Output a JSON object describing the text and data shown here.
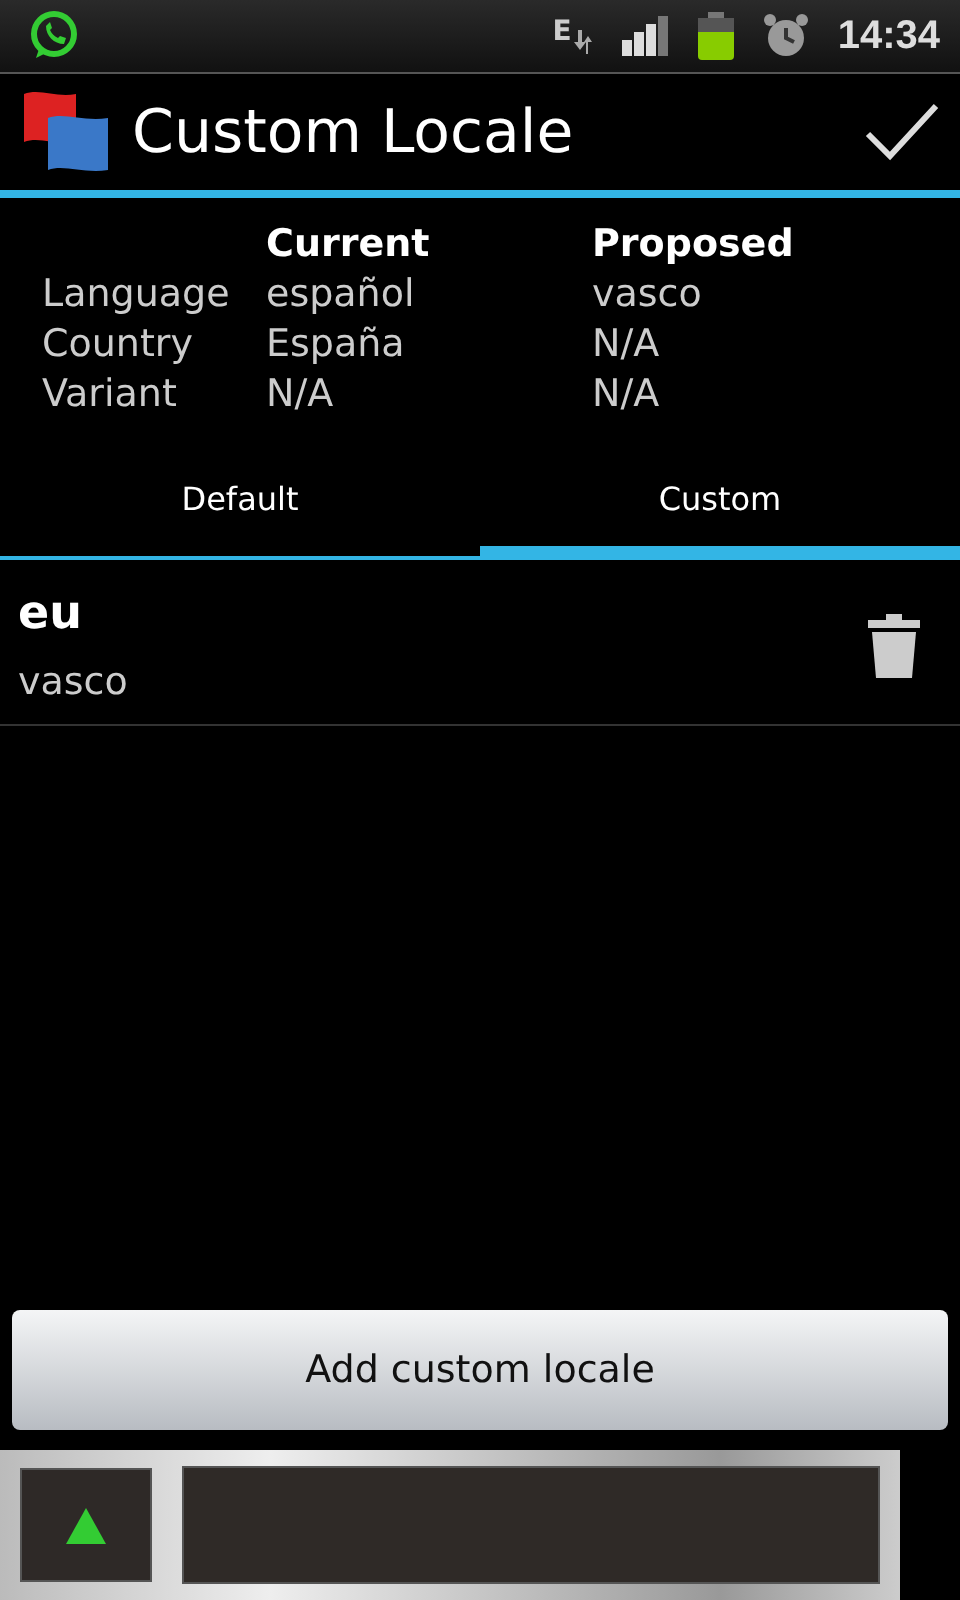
{
  "status_bar": {
    "network": "E",
    "time": "14:34"
  },
  "action_bar": {
    "title": "Custom Locale"
  },
  "locale_table": {
    "headers": [
      "Current",
      "Proposed"
    ],
    "rows": [
      {
        "label": "Language",
        "current": "español",
        "proposed": "vasco"
      },
      {
        "label": "Country",
        "current": "España",
        "proposed": "N/A"
      },
      {
        "label": "Variant",
        "current": "N/A",
        "proposed": "N/A"
      }
    ]
  },
  "tabs": [
    {
      "label": "Default",
      "selected": false
    },
    {
      "label": "Custom",
      "selected": true
    }
  ],
  "locales": [
    {
      "code": "eu",
      "name": "vasco"
    }
  ],
  "add_button": "Add custom locale"
}
